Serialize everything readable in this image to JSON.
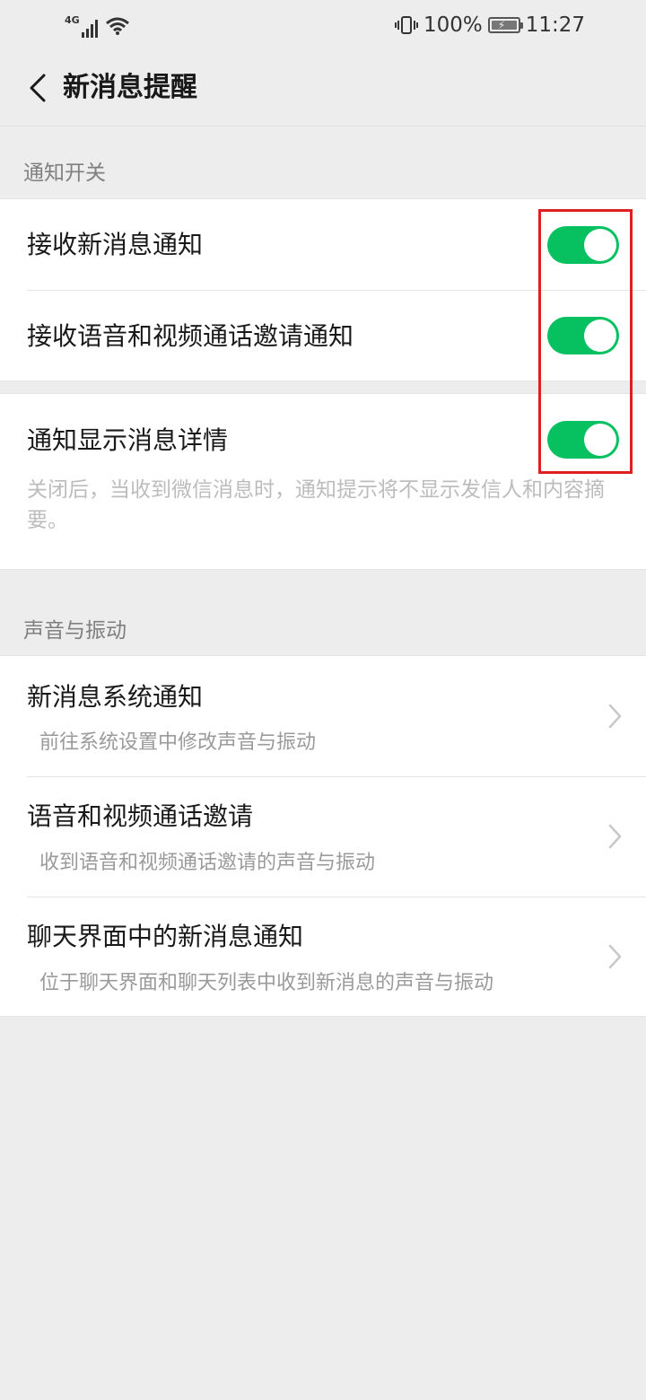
{
  "status_bar": {
    "network": "4G",
    "battery_percent": "100%",
    "time": "11:27"
  },
  "nav": {
    "title": "新消息提醒"
  },
  "sections": {
    "notify_switch": {
      "header": "通知开关",
      "items": [
        {
          "label": "接收新消息通知",
          "enabled": true
        },
        {
          "label": "接收语音和视频通话邀请通知",
          "enabled": true
        }
      ],
      "details": {
        "label": "通知显示消息详情",
        "enabled": true,
        "description": "关闭后，当收到微信消息时，通知提示将不显示发信人和内容摘要。"
      }
    },
    "sound_vibration": {
      "header": "声音与振动",
      "items": [
        {
          "label": "新消息系统通知",
          "subtitle": "前往系统设置中修改声音与振动"
        },
        {
          "label": "语音和视频通话邀请",
          "subtitle": "收到语音和视频通话邀请的声音与振动"
        },
        {
          "label": "聊天界面中的新消息通知",
          "subtitle": "位于聊天界面和聊天列表中收到新消息的声音与振动"
        }
      ]
    }
  },
  "colors": {
    "toggle_on": "#07c160",
    "background": "#ededed",
    "highlight": "#e02020"
  }
}
